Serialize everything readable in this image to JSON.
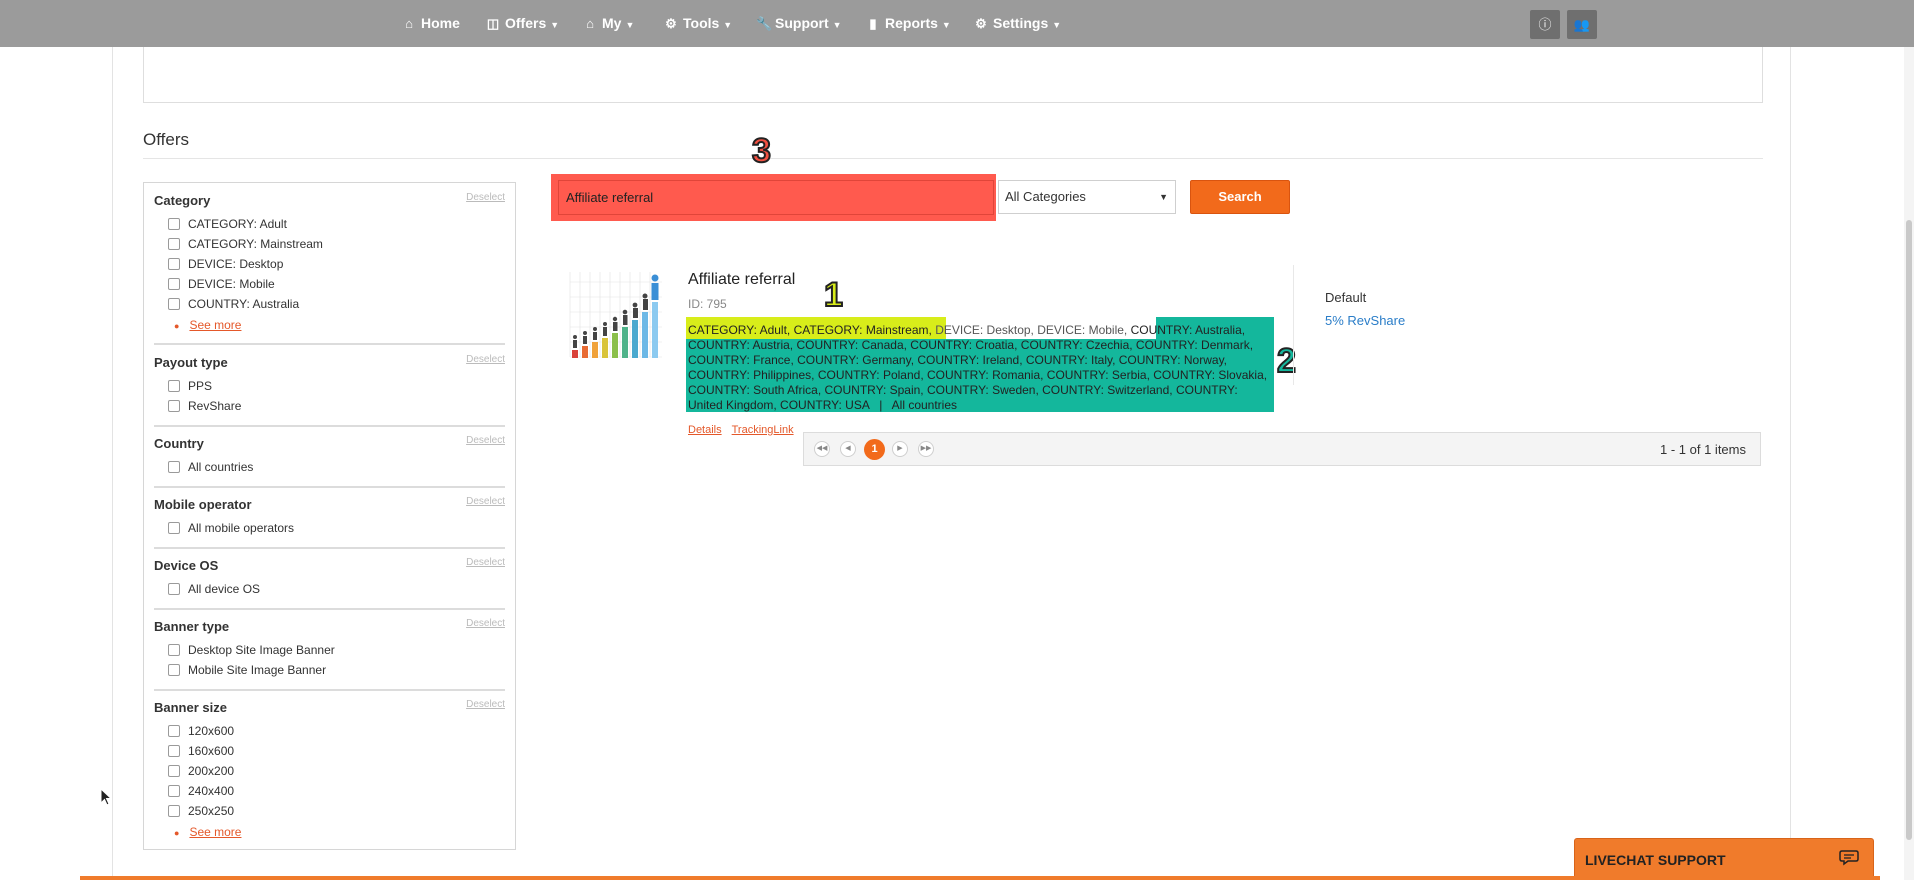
{
  "nav": {
    "items": [
      {
        "label": "Home",
        "icon": "home-icon",
        "caret": false
      },
      {
        "label": "Offers",
        "icon": "offers-icon",
        "caret": true
      },
      {
        "label": "My",
        "icon": "home-icon",
        "caret": true
      },
      {
        "label": "Tools",
        "icon": "gear-icon",
        "caret": true
      },
      {
        "label": "Support",
        "icon": "wrench-icon",
        "caret": true
      },
      {
        "label": "Reports",
        "icon": "bar-chart-icon",
        "caret": true
      },
      {
        "label": "Settings",
        "icon": "gear-icon",
        "caret": true
      }
    ],
    "right_buttons": [
      "info-icon",
      "users-icon"
    ]
  },
  "section_title": "Offers",
  "filters": {
    "deselect_label": "Deselect",
    "see_more_label": "See more",
    "groups": [
      {
        "title": "Category",
        "options": [
          "CATEGORY: Adult",
          "CATEGORY: Mainstream",
          "DEVICE: Desktop",
          "DEVICE: Mobile",
          "COUNTRY: Australia"
        ],
        "see_more": true
      },
      {
        "title": "Payout type",
        "options": [
          "PPS",
          "RevShare"
        ],
        "see_more": false
      },
      {
        "title": "Country",
        "options": [
          "All countries"
        ],
        "see_more": false
      },
      {
        "title": "Mobile operator",
        "options": [
          "All mobile operators"
        ],
        "see_more": false
      },
      {
        "title": "Device OS",
        "options": [
          "All device OS"
        ],
        "see_more": false
      },
      {
        "title": "Banner type",
        "options": [
          "Desktop Site Image Banner",
          "Mobile Site Image Banner"
        ],
        "see_more": false
      },
      {
        "title": "Banner size",
        "options": [
          "120x600",
          "160x600",
          "200x200",
          "240x400",
          "250x250"
        ],
        "see_more": true
      }
    ]
  },
  "search": {
    "value": "Affiliate referral",
    "category_selected": "All Categories",
    "button_label": "Search"
  },
  "annotations": [
    "1",
    "2",
    "3"
  ],
  "offer": {
    "title": "Affiliate referral",
    "id": "ID: 795",
    "tags_yellow": "CATEGORY: Adult, CATEGORY: Mainstream,",
    "tags_plain": " DEVICE: Desktop, DEVICE: Mobile, ",
    "tags_teal": "COUNTRY: Australia, COUNTRY: Austria, COUNTRY: Canada, COUNTRY: Croatia, COUNTRY: Czechia, COUNTRY: Denmark, COUNTRY: France, COUNTRY: Germany, COUNTRY: Ireland, COUNTRY: Italy, COUNTRY: Norway, COUNTRY: Philippines, COUNTRY: Poland, COUNTRY: Romania, COUNTRY: Serbia, COUNTRY: Slovakia, COUNTRY: South Africa, COUNTRY: Spain, COUNTRY: Sweden, COUNTRY: Switzerland, COUNTRY: United Kingdom, COUNTRY: USA",
    "tags_sep": "   |   ",
    "tags_countries": "All countries",
    "link_details": "Details",
    "link_tracking": "TrackingLink",
    "payout_label": "Default",
    "payout_value": "5% RevShare"
  },
  "pager": {
    "current": "1",
    "info": "1 - 1 of 1 items"
  },
  "livechat": {
    "label": "LIVECHAT SUPPORT"
  },
  "colors": {
    "accent": "#f26a1b",
    "highlight_red": "#ff5a4e",
    "highlight_yellow": "#d8ed1a",
    "highlight_teal": "#14b79c",
    "nav_bg": "#9b9b9b"
  }
}
